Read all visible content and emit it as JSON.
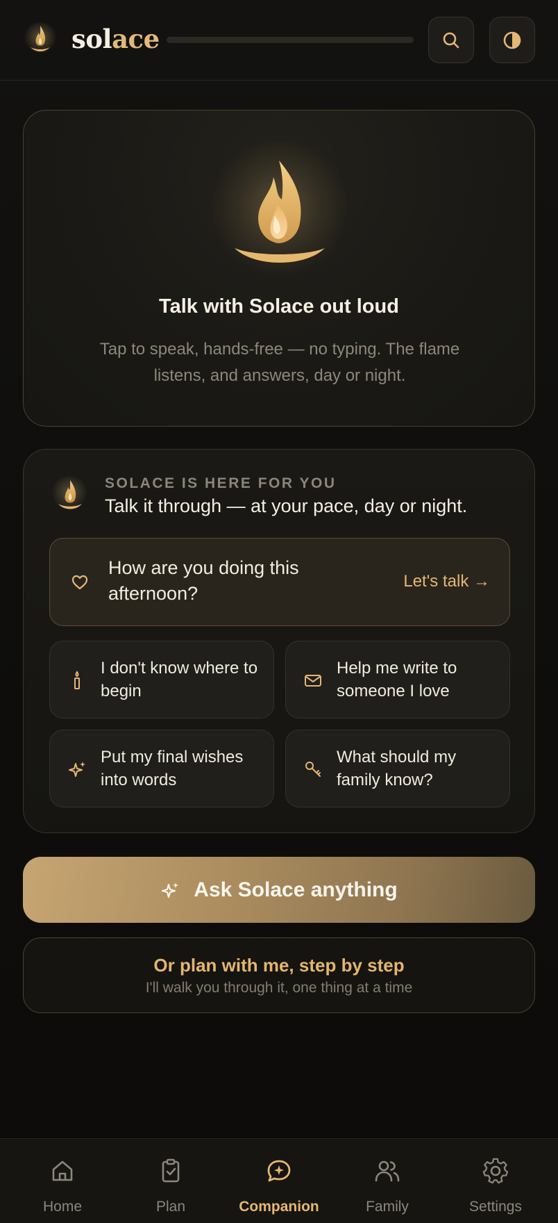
{
  "header": {
    "brand_part1": "sol",
    "brand_part2": "ace",
    "progress": 0,
    "icons": [
      "flame-logo-icon",
      "search-icon",
      "contrast-icon"
    ]
  },
  "voice_card": {
    "title": "Talk with Solace out loud",
    "subtitle": "Tap to speak, hands-free — no typing. The flame listens, and answers, day or night."
  },
  "companion": {
    "kicker": "SOLACE IS HERE FOR YOU",
    "heading": "Talk it through — at your pace, day or night.",
    "featured": {
      "question": "How are you doing this afternoon?",
      "cta": "Let's talk →",
      "icon": "heart-icon"
    },
    "chips": [
      {
        "label": "I don't know where to begin",
        "icon": "candle-icon"
      },
      {
        "label": "Help me write to someone I love",
        "icon": "envelope-icon"
      },
      {
        "label": "Put my final wishes into words",
        "icon": "sparkles-icon"
      },
      {
        "label": "What should my family know?",
        "icon": "key-icon"
      }
    ]
  },
  "ask_button": {
    "label": "Ask Solace anything",
    "icon": "sparkles-icon"
  },
  "plan_button": {
    "title": "Or plan with me, step by step",
    "subtitle": "I'll walk you through it, one thing at a time"
  },
  "nav": {
    "items": [
      {
        "label": "Home",
        "icon": "home-icon",
        "active": false
      },
      {
        "label": "Plan",
        "icon": "clipboard-icon",
        "active": false
      },
      {
        "label": "Companion",
        "icon": "chat-sparkle-icon",
        "active": true
      },
      {
        "label": "Family",
        "icon": "people-icon",
        "active": false
      },
      {
        "label": "Settings",
        "icon": "gear-icon",
        "active": false
      }
    ]
  },
  "colors": {
    "background": "#0f0e0c",
    "accent": "#e3b776",
    "accent_button": "#c6a572",
    "card_border": "#4b4230",
    "muted_text": "#8e877a"
  }
}
